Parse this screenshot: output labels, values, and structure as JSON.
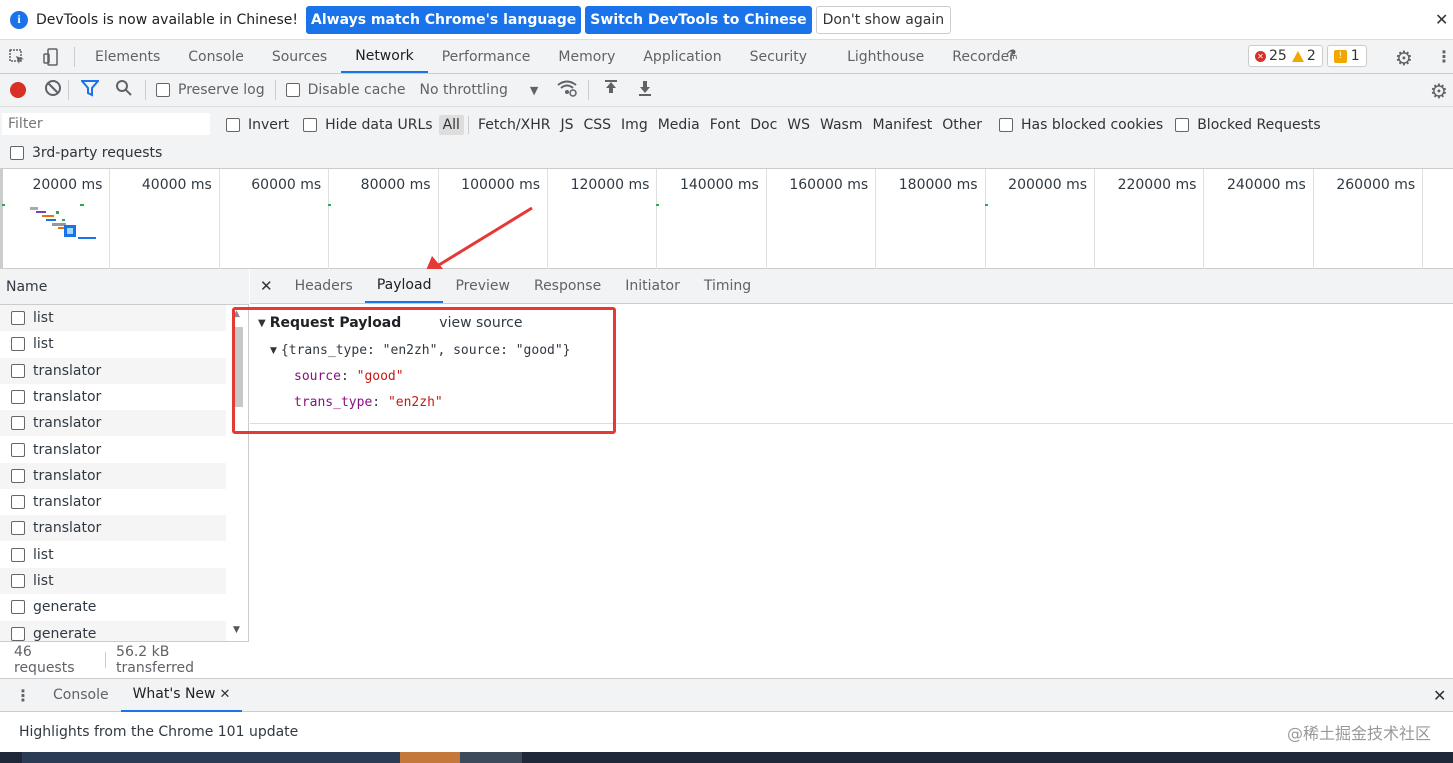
{
  "infobar": {
    "message": "DevTools is now available in Chinese!",
    "btn_match": "Always match Chrome's language",
    "btn_switch": "Switch DevTools to Chinese",
    "btn_dismiss": "Don't show again"
  },
  "maintabs": [
    "Elements",
    "Console",
    "Sources",
    "Network",
    "Performance",
    "Memory",
    "Application",
    "Security",
    "Lighthouse",
    "Recorder"
  ],
  "active_maintab": "Network",
  "issues": {
    "errors": "25",
    "warnings": "2",
    "info": "1"
  },
  "nettools": {
    "preserve_log": "Preserve log",
    "disable_cache": "Disable cache",
    "throttling": "No throttling"
  },
  "filterbar": {
    "placeholder": "Filter",
    "invert": "Invert",
    "hide_data_urls": "Hide data URLs",
    "types": [
      "All",
      "Fetch/XHR",
      "JS",
      "CSS",
      "Img",
      "Media",
      "Font",
      "Doc",
      "WS",
      "Wasm",
      "Manifest",
      "Other"
    ],
    "has_blocked_cookies": "Has blocked cookies",
    "blocked_requests": "Blocked Requests",
    "third_party": "3rd-party requests"
  },
  "overview_ticks": [
    "20000 ms",
    "40000 ms",
    "60000 ms",
    "80000 ms",
    "100000 ms",
    "120000 ms",
    "140000 ms",
    "160000 ms",
    "180000 ms",
    "200000 ms",
    "220000 ms",
    "240000 ms",
    "260000 ms"
  ],
  "reqlist": {
    "header": "Name",
    "rows": [
      "list",
      "list",
      "translator",
      "translator",
      "translator",
      "translator",
      "translator",
      "translator",
      "translator",
      "list",
      "list",
      "generate",
      "generate"
    ],
    "footer_requests": "46 requests",
    "footer_transferred": "56.2 kB transferred"
  },
  "details": {
    "tabs": [
      "Headers",
      "Payload",
      "Preview",
      "Response",
      "Initiator",
      "Timing"
    ],
    "active_tab": "Payload",
    "section_title": "Request Payload",
    "view_source": "view source",
    "object_summary": "{trans_type: \"en2zh\", source: \"good\"}",
    "props": [
      {
        "key": "source",
        "value": "\"good\""
      },
      {
        "key": "trans_type",
        "value": "\"en2zh\""
      }
    ]
  },
  "drawer": {
    "tabs": [
      "Console",
      "What's New"
    ],
    "active_tab": "What's New",
    "body": "Highlights from the Chrome 101 update"
  },
  "watermark": "@稀土掘金技术社区"
}
